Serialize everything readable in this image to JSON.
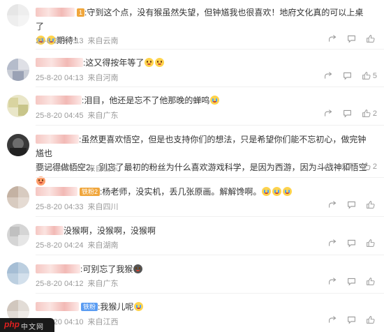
{
  "comments": [
    {
      "badge": "1",
      "text": ":守到这个点，没有猴虽然失望，但钟馗我也很喜欢！地府文化真的可以上桌了",
      "text2": "期待！",
      "date": "25-8-20 04:13",
      "loc": "来自云南",
      "likes": ""
    },
    {
      "text": ":这又得按年等了",
      "date": "25-8-20 04:13",
      "loc": "来自河南",
      "likes": "5"
    },
    {
      "text": ":泪目，他还是忘不了他那晚的蝉鸣",
      "date": "25-8-20 04:45",
      "loc": "来自广东",
      "likes": "2"
    },
    {
      "text": ":虽然更喜欢悟空，但是也支持你们的想法，只是希望你们能不忘初心，做完钟馗也",
      "text2": "要记得做悟空2，别忘了最初的粉丝为什么喜欢游戏科学，是因为西游，因为斗战神和悟空",
      "date": "25-8-20 04:39",
      "loc": "来自山东",
      "likes": "2"
    },
    {
      "badge": "铁粉2",
      "text": ":杨老师，没实机，丢几张原画。解解馋啊。",
      "date": "25-8-20 04:33",
      "loc": "来自四川",
      "likes": ""
    },
    {
      "text": "没猴啊，没猴啊，没猴啊",
      "date": "25-8-20 04:24",
      "loc": "来自湖南",
      "likes": ""
    },
    {
      "text": ":可别忘了我猴",
      "date": "25-8-20 04:12",
      "loc": "来自广东",
      "likes": ""
    },
    {
      "badge": "铁粉",
      "text": ":我猴儿呢",
      "date": "25-8-20 04:10",
      "loc": "来自江西",
      "likes": ""
    }
  ],
  "icons": {
    "share": "share-icon",
    "reply": "comment-icon",
    "like": "like-icon"
  },
  "watermark": {
    "brand": "php",
    "site": "中文网"
  },
  "colors": {
    "meta": "#999999",
    "text": "#333333",
    "name_blur": "#f5c7c3"
  }
}
